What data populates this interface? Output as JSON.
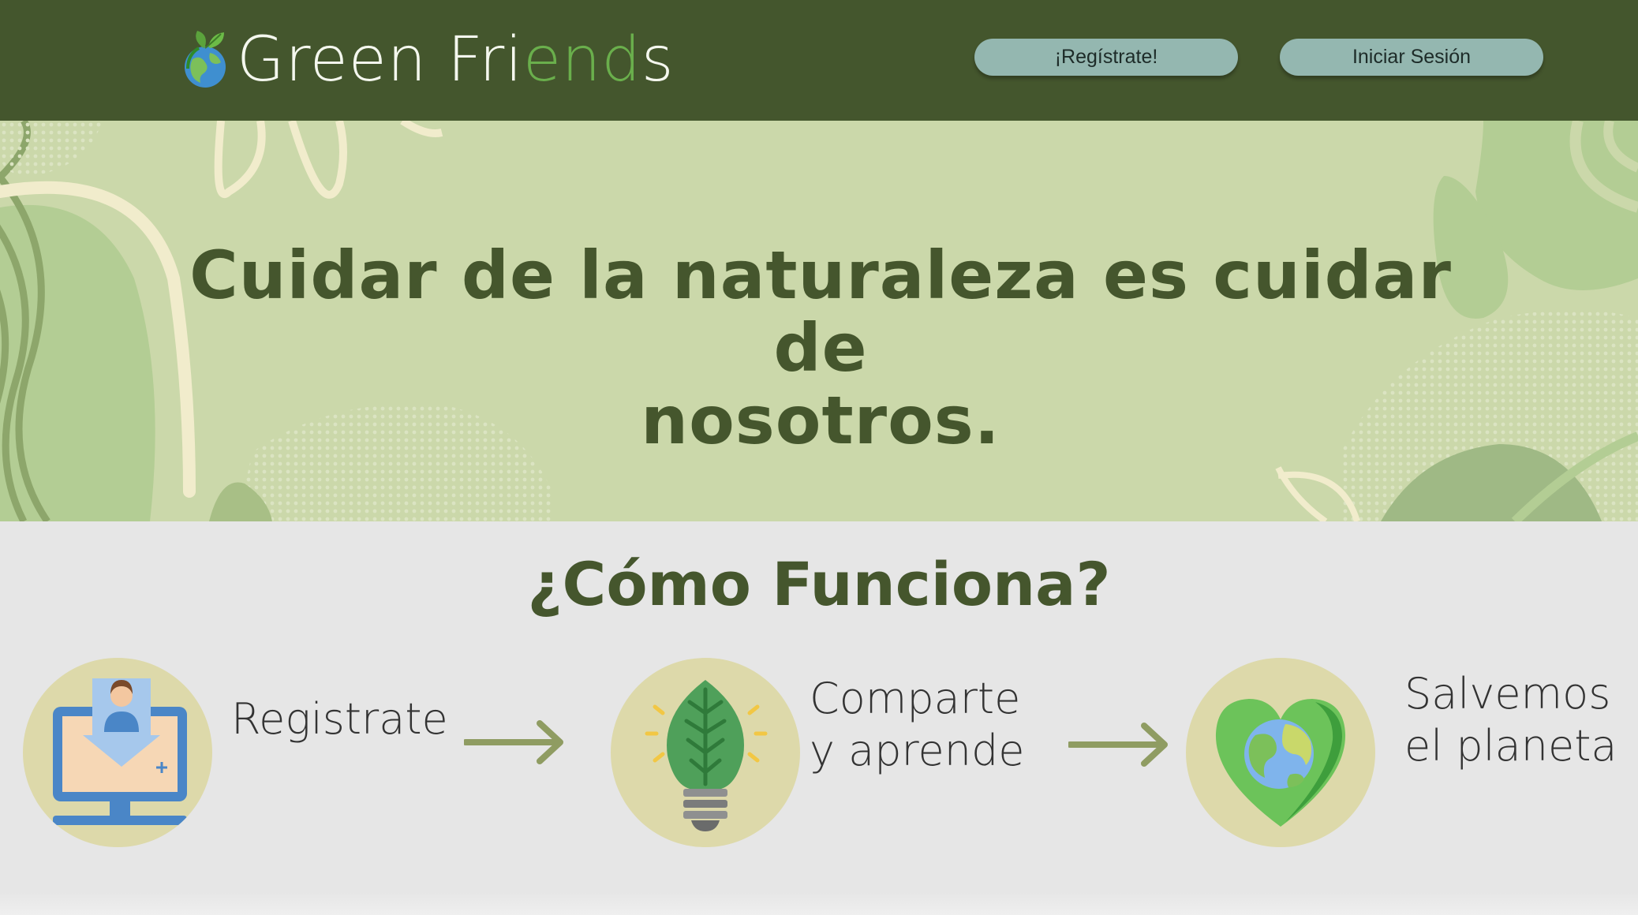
{
  "header": {
    "brand": {
      "part1": "Green Fri",
      "part2": "end",
      "part3": "s",
      "icon": "globe-leaf-icon"
    },
    "register_label": "¡Regístrate!",
    "login_label": "Iniciar Sesión"
  },
  "hero": {
    "title_line1": "Cuidar de la naturaleza es cuidar de",
    "title_line2": "nosotros."
  },
  "how": {
    "title": "¿Cómo Funciona?",
    "steps": [
      {
        "icon": "computer-user-icon",
        "line1": "Registrate",
        "line2": ""
      },
      {
        "icon": "leaf-lightbulb-icon",
        "line1": "Comparte",
        "line2": "y aprende"
      },
      {
        "icon": "heart-earth-icon",
        "line1": "Salvemos",
        "line2": "el planeta"
      }
    ],
    "arrow_icon": "arrow-right-icon"
  },
  "colors": {
    "header_bg": "#44562d",
    "hero_bg": "#cbd8aa",
    "button_bg": "#94b7b0",
    "title_color": "#45562d",
    "section_bg": "#e6e6e6",
    "step_circle": "#ddd9aa"
  }
}
